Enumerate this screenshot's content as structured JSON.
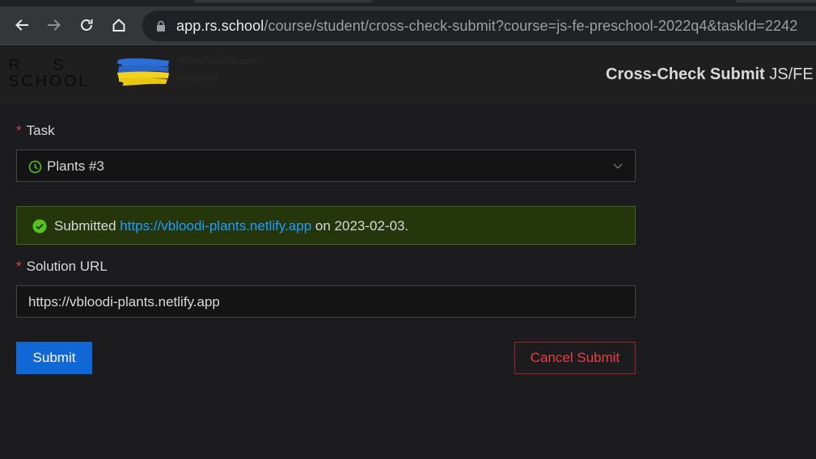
{
  "browser": {
    "url_host": "app.rs.school",
    "url_path": "/course/student/cross-check-submit?course=js-fe-preschool-2022q4&taskId=2242",
    "icons": [
      "back-icon",
      "forward-icon",
      "reload-icon",
      "home-icon",
      "lock-icon"
    ]
  },
  "header": {
    "logo_line1": "R S",
    "logo_line2": "SCHOOL",
    "slogan_1": "#StandWithUkraine",
    "slogan_2": "#StopWar",
    "title_bold": "Cross-Check Submit",
    "title_rest": "JS/FE P"
  },
  "form": {
    "task_label": "Task",
    "task_value": "Plants #3",
    "alert": {
      "prefix": "Submitted",
      "link": "https://vbloodi-plants.netlify.app",
      "suffix": "on 2023-02-03."
    },
    "solution_label": "Solution URL",
    "solution_value": "https://vbloodi-plants.netlify.app",
    "submit_label": "Submit",
    "cancel_label": "Cancel Submit"
  },
  "colors": {
    "primary": "#1167d6",
    "danger": "#ea3d44",
    "success": "#52c41a",
    "link": "#1f9dff"
  }
}
